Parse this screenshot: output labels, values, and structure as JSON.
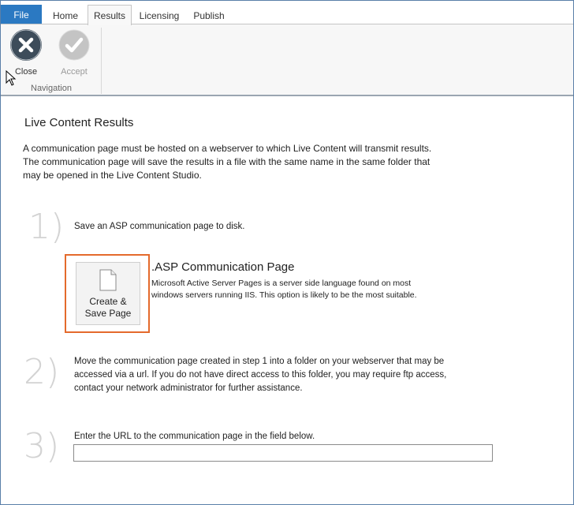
{
  "ribbon": {
    "tabs": [
      "File",
      "Home",
      "Results",
      "Licensing",
      "Publish"
    ],
    "active_tab": "Results",
    "buttons": {
      "close": "Close",
      "accept": "Accept"
    },
    "group_label": "Navigation"
  },
  "content": {
    "title": "Live Content Results",
    "intro_lines": [
      "A communication page must be hosted on a webserver to which Live Content will transmit results.",
      "The communication page will save the results in a file with the same name in the same folder that",
      "may be opened in the Live Content Studio."
    ],
    "step1": {
      "number": "1)",
      "text": "Save an ASP communication page to disk.",
      "button_lines": [
        "Create &",
        "Save Page"
      ],
      "option_title": ".ASP Communication Page",
      "option_desc_lines": [
        "Microsoft Active Server Pages is a server side language found on most",
        "windows servers running IIS. This option is likely to be the most suitable."
      ]
    },
    "step2": {
      "number": "2)",
      "text_lines": [
        "Move the communication page created in step 1 into a folder on your webserver that may be",
        "accessed via a url. If you do not have direct access to this folder, you may require ftp access,",
        "contact your network administrator for further assistance."
      ]
    },
    "step3": {
      "number": "3)",
      "text": "Enter the URL to the communication page in the field below.",
      "url_value": ""
    }
  },
  "colors": {
    "file_tab": "#2b79c2",
    "highlight_border": "#e46a2c",
    "close_icon": "#3d4c5a",
    "accept_icon": "#bfbfbf"
  }
}
